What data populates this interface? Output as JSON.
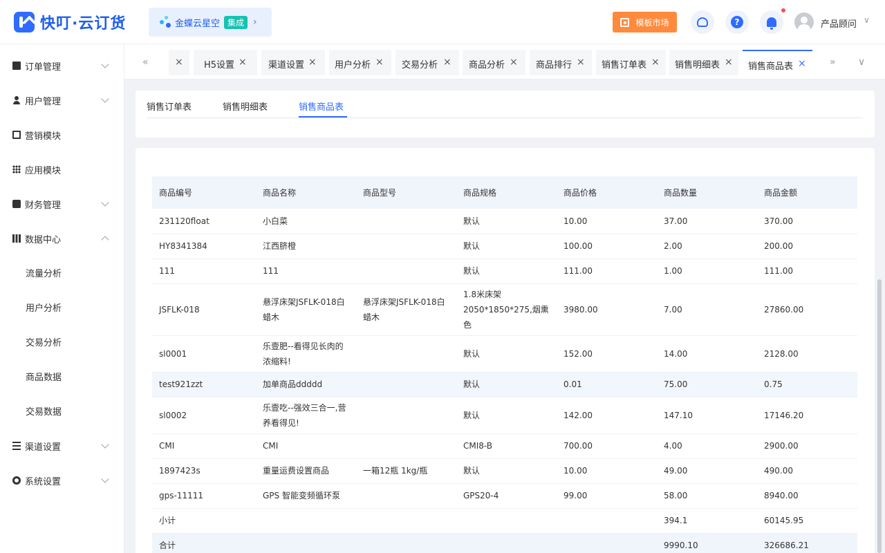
{
  "brand": {
    "name": "快叮·云订货",
    "accent": "#2f6bff"
  },
  "integration": {
    "name": "金蝶云星空",
    "tag": "集成",
    "arrow": "›"
  },
  "header": {
    "market_label": "模板市场",
    "user_name": "产品顾问",
    "user_caret": "∨",
    "help_glyph": "?"
  },
  "sidebar": {
    "items": [
      {
        "label": "订单管理",
        "icon": "order-icon",
        "expandable": true
      },
      {
        "label": "用户管理",
        "icon": "user-icon",
        "expandable": true
      },
      {
        "label": "营销模块",
        "icon": "trend-icon",
        "expandable": false
      },
      {
        "label": "应用模块",
        "icon": "grid-icon",
        "expandable": false
      },
      {
        "label": "财务管理",
        "icon": "wallet-icon",
        "expandable": true
      },
      {
        "label": "数据中心",
        "icon": "bar-chart-icon",
        "expandable": true,
        "expanded": true
      },
      {
        "label": "渠道设置",
        "icon": "list-icon",
        "expandable": true
      },
      {
        "label": "系统设置",
        "icon": "gear-icon",
        "expandable": true
      }
    ],
    "data_center_children": [
      "流量分析",
      "用户分析",
      "交易分析",
      "商品数据",
      "交易数据"
    ]
  },
  "tabbar": {
    "prev": "«",
    "next": "»",
    "menu": "∨",
    "close_glyph": "×",
    "tabs": [
      "",
      "H5设置",
      "渠道设置",
      "用户分析",
      "交易分析",
      "商品分析",
      "商品排行",
      "销售订单表",
      "销售明细表",
      "销售商品表"
    ],
    "active_index": 9
  },
  "subtabs": {
    "items": [
      "销售订单表",
      "销售明细表",
      "销售商品表"
    ],
    "active_index": 2
  },
  "table": {
    "columns": [
      "商品编号",
      "商品名称",
      "商品型号",
      "商品规格",
      "商品价格",
      "商品数量",
      "商品金额"
    ],
    "rows": [
      [
        "231120float",
        "小白菜",
        "",
        "默认",
        "10.00",
        "37.00",
        "370.00"
      ],
      [
        "HY8341384",
        "江西脐橙",
        "",
        "默认",
        "100.00",
        "2.00",
        "200.00"
      ],
      [
        "111",
        "111",
        "",
        "默认",
        "111.00",
        "1.00",
        "111.00"
      ],
      [
        "JSFLK-018",
        "悬浮床架JSFLK-018白蜡木",
        "悬浮床架JSFLK-018白蜡木",
        "1.8米床架 2050*1850*275,烟熏色",
        "3980.00",
        "7.00",
        "27860.00"
      ],
      [
        "sl0001",
        "乐壹肥--看得见长肉的浓缩料!",
        "",
        "默认",
        "152.00",
        "14.00",
        "2128.00"
      ],
      [
        "test921zzt",
        "加单商品ddddd",
        "",
        "默认",
        "0.01",
        "75.00",
        "0.75"
      ],
      [
        "sl0002",
        "乐壹吃--强效三合一,营养看得见!",
        "",
        "默认",
        "142.00",
        "147.10",
        "17146.20"
      ],
      [
        "CMI",
        "CMI",
        "",
        "CMI8-B",
        "700.00",
        "4.00",
        "2900.00"
      ],
      [
        "1897423s",
        "重量运费设置商品",
        "一箱12瓶 1kg/瓶",
        "默认",
        "10.00",
        "49.00",
        "490.00"
      ],
      [
        "gps-11111",
        "GPS 智能变频循环泵",
        "",
        "GPS20-4",
        "99.00",
        "58.00",
        "8940.00"
      ]
    ],
    "highlighted_row": 5,
    "subtotal": {
      "label": "小计",
      "quantity": "394.1",
      "amount": "60145.95"
    },
    "total": {
      "label": "合计",
      "quantity": "9990.10",
      "amount": "326686.21"
    }
  }
}
